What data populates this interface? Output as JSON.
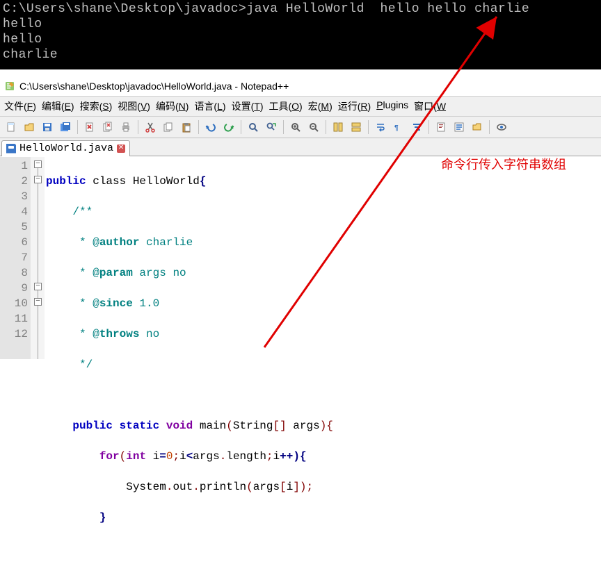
{
  "console": {
    "prompt": "C:\\Users\\shane\\Desktop\\javadoc>java HelloWorld  hello hello charlie",
    "out1": "hello",
    "out2": "hello",
    "out3": "charlie"
  },
  "window": {
    "title": "C:\\Users\\shane\\Desktop\\javadoc\\HelloWorld.java - Notepad++"
  },
  "menus": [
    {
      "text": "文件(",
      "amp": "F",
      "tail": ")"
    },
    {
      "text": "编辑(",
      "amp": "E",
      "tail": ")"
    },
    {
      "text": "搜索(",
      "amp": "S",
      "tail": ")"
    },
    {
      "text": "视图(",
      "amp": "V",
      "tail": ")"
    },
    {
      "text": "编码(",
      "amp": "N",
      "tail": ")"
    },
    {
      "text": "语言(",
      "amp": "L",
      "tail": ")"
    },
    {
      "text": "设置(",
      "amp": "T",
      "tail": ")"
    },
    {
      "text": "工具(",
      "amp": "O",
      "tail": ")"
    },
    {
      "text": "宏(",
      "amp": "M",
      "tail": ")"
    },
    {
      "text": "运行(",
      "amp": "R",
      "tail": ")"
    },
    {
      "text": "",
      "amp": "P",
      "tail": "lugins"
    },
    {
      "text": "窗口(",
      "amp": "W",
      "tail": ""
    }
  ],
  "tab": {
    "name": "HelloWorld.java"
  },
  "gutter": [
    "1",
    "2",
    "3",
    "4",
    "5",
    "6",
    "7",
    "8",
    "9",
    "10",
    "11",
    "12"
  ],
  "code": {
    "l1a": "public",
    "l1b": " class ",
    "l1c": "HelloWorld",
    "l1d": "{",
    "l2": "    /**",
    "l3a": "     * @",
    "l3b": "author",
    "l3c": " charlie",
    "l4a": "     * @",
    "l4b": "param",
    "l4c": " args no",
    "l5a": "     * @",
    "l5b": "since",
    "l5c": " 1.0",
    "l6a": "     * @",
    "l6b": "throws",
    "l6c": " no",
    "l7": "     */",
    "l8": "",
    "l9a": "    public",
    "l9b": " static",
    "l9c": " void",
    "l9d": " main",
    "l9e": "(",
    "l9f": "String",
    "l9g": "[] ",
    "l9h": "args",
    "l9i": "){",
    "l10a": "        for",
    "l10b": "(",
    "l10c": "int",
    "l10d": " i",
    "l10e": "=",
    "l10f": "0",
    "l10g": ";",
    "l10h": "i",
    "l10i": "<",
    "l10j": "args",
    "l10k": ".",
    "l10l": "length",
    "l10m": ";",
    "l10n": "i",
    "l10o": "++){",
    "l11a": "            System",
    "l11b": ".",
    "l11c": "out",
    "l11d": ".",
    "l11e": "println",
    "l11f": "(",
    "l11g": "args",
    "l11h": "[",
    "l11i": "i",
    "l11j": "]);",
    "l12": "        }"
  },
  "annotation": "命令行传入字符串数组"
}
